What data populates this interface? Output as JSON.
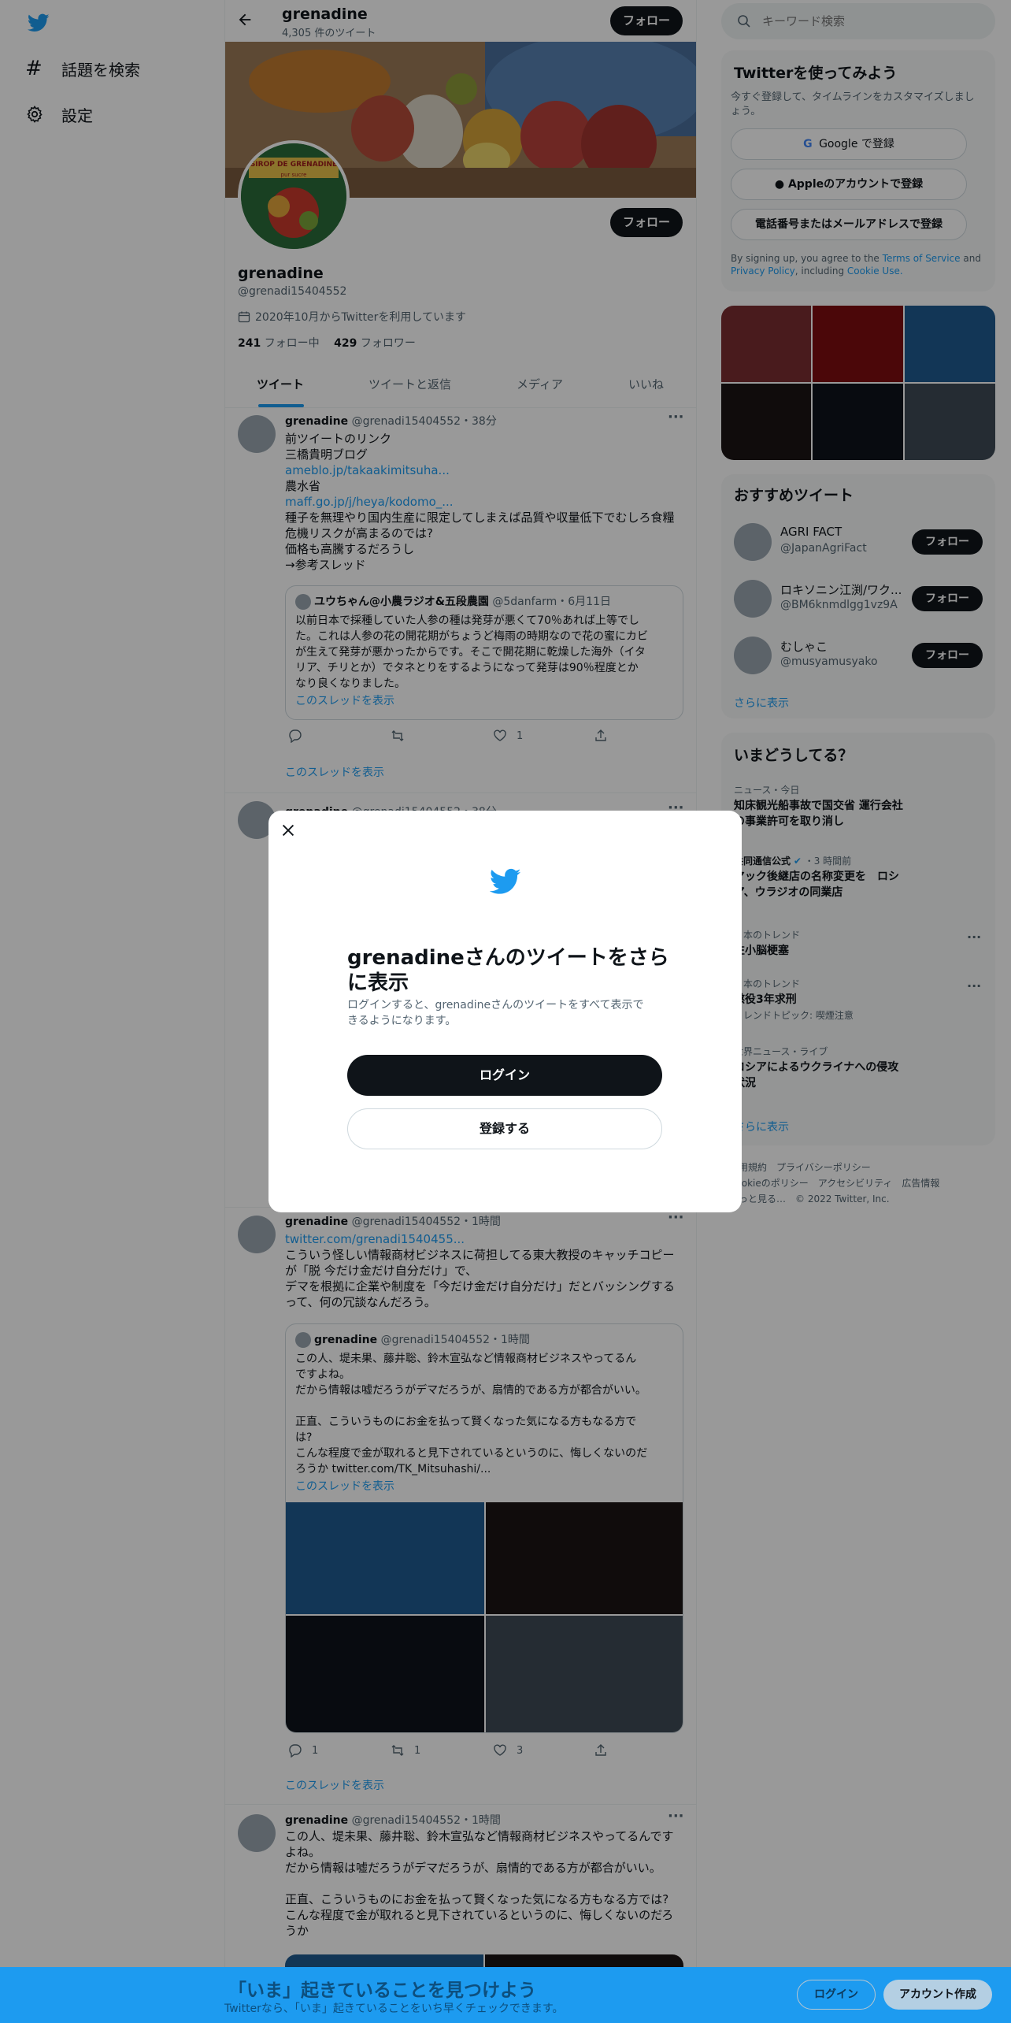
{
  "left_nav": {
    "explore_label": "話題を検索",
    "settings_label": "設定"
  },
  "header": {
    "name": "grenadine",
    "tweet_count": "4,305 件のツイート",
    "follow_label": "フォロー"
  },
  "banner": {
    "avatar_text_top": "SIROP DE GRENADINE",
    "avatar_text_sub": "pur sucre"
  },
  "profile": {
    "follow_label": "フォロー",
    "name": "grenadine",
    "handle": "@grenadi15404552",
    "joined": "2020年10月からTwitterを利用しています",
    "following_count": "241",
    "following_label": "フォロー中",
    "followers_count": "429",
    "followers_label": "フォロワー"
  },
  "tabs": [
    "ツイート",
    "ツイートと返信",
    "メディア",
    "いいね"
  ],
  "tweet1": {
    "name": "grenadine",
    "meta": "@grenadi15404552・38分",
    "lines": [
      "前ツイートのリンク",
      "三橋貴明ブログ"
    ],
    "link1": "ameblo.jp/takaakimitsuha...",
    "line3": "農水省",
    "link2": "maff.go.jp/j/heya/kodomo_...",
    "lines2": [
      "種子を無理やり国内生産に限定してしまえば品質や収量低下でむしろ食糧",
      "危機リスクが高まるのでは?",
      "価格も高騰するだろうし",
      "→参考スレッド"
    ],
    "quote": {
      "name": "ユウちゃん@小農ラジオ&五段農園",
      "meta": "@5danfarm・6月11日",
      "lines": [
        "以前日本で採種していた人参の種は発芽が悪くて70％あれば上等でし",
        "た。これは人参の花の開花期がちょうど梅雨の時期なので花の蜜にカビ",
        "が生えて発芽が悪かったからです。そこで開花期に乾燥した海外（イタ",
        "リア、チリとか）でタネとりをするようになって発芽は90％程度とか",
        "なり良くなりました。"
      ],
      "thread_link": "このスレッドを表示"
    },
    "like_count": "1",
    "thread_link": "このスレッドを表示"
  },
  "tweet2": {
    "name": "grenadine",
    "meta": "@grenadi15404552・38分"
  },
  "tweet3": {
    "name": "grenadine",
    "meta": "@grenadi15404552・1時間",
    "link": "twitter.com/grenadi1540455...",
    "lines": [
      "こういう怪しい情報商材ビジネスに荷担してる東大教授のキャッチコピー",
      "が「脱 今だけ金だけ自分だけ」で、",
      "デマを根拠に企業や制度を「今だけ金だけ自分だけ」だとバッシングする",
      "って、何の冗談なんだろう。"
    ],
    "quote": {
      "name": "grenadine",
      "meta": "@grenadi15404552・1時間",
      "lines": [
        "この人、堤未果、藤井聡、鈴木宣弘など情報商材ビジネスやってるん",
        "ですよね。",
        "だから情報は嘘だろうがデマだろうが、扇情的である方が都合がいい。",
        "",
        "正直、こういうものにお金を払って賢くなった気になる方もなる方で",
        "は?",
        "こんな程度で金が取れると見下されているというのに、悔しくないのだ",
        "ろうか  twitter.com/TK_Mitsuhashi/..."
      ],
      "thread_link": "このスレッドを表示"
    },
    "reply_count": "1",
    "retweet_count": "1",
    "like_count": "3",
    "thread_link": "このスレッドを表示"
  },
  "tweet4": {
    "name": "grenadine",
    "meta": "@grenadi15404552・1時間",
    "lines": [
      "この人、堤未果、藤井聡、鈴木宣弘など情報商材ビジネスやってるんです",
      "よね。",
      "だから情報は嘘だろうがデマだろうが、扇情的である方が都合がいい。",
      "",
      "正直、こういうものにお金を払って賢くなった気になる方もなる方では?",
      "こんな程度で金が取れると見下されているというのに、悔しくないのだろ",
      "うか"
    ]
  },
  "search": {
    "placeholder": "キーワード検索"
  },
  "signup": {
    "title": "Twitterを使ってみよう",
    "subtitle_lines": [
      "今すぐ登録して、タイムラインをカスタマイズしまし",
      "ょう。"
    ],
    "google_label": "Google で登録",
    "apple_label": "Appleのアカウントで登録",
    "phone_label": "電話番号またはメールアドレスで登録",
    "terms_pre": "By signing up, you agree to the",
    "terms_link": "Terms of Service",
    "terms_and": "and",
    "privacy_link": "Privacy Policy",
    "including": ", including",
    "cookie_link": "Cookie Use."
  },
  "colors": {
    "accent": "#1d9bf0",
    "grid": [
      "#7b2e31",
      "#7e0d0f",
      "#1f5b8f",
      "#1b1415",
      "#0e131c",
      "#3f4a56"
    ]
  },
  "recommend": {
    "title": "おすすめツイート",
    "users": [
      {
        "name": "AGRI FACT",
        "handle": "@JapanAgriFact",
        "follow": "フォロー"
      },
      {
        "name": "ロキソニン江渕/ワク...",
        "handle": "@BM6knmdlgg1vz9A",
        "follow": "フォロー"
      },
      {
        "name": "むしゃこ",
        "handle": "@musyamusyako",
        "follow": "フォロー"
      }
    ],
    "more": "さらに表示"
  },
  "trends": {
    "title": "いまどうしてる？",
    "items": [
      {
        "meta": "ニュース・今日",
        "title_lines": [
          "知床観光船事故で国交省 運行会社",
          "の事業許可を取り消し"
        ]
      },
      {
        "meta": "共同通信公式",
        "meta2": "・3 時間前",
        "title_lines": [
          "マック後継店の名称変更を　ロシ",
          "ア、ウラジオの同業店"
        ]
      },
      {
        "meta": "日本のトレンド",
        "title_lines": [
          "左小脳梗塞"
        ]
      },
      {
        "meta": "日本のトレンド",
        "title_lines": [
          "懲役3年求刑"
        ],
        "extra": "トレンドトピック: 喫煙注意"
      },
      {
        "meta": "世界ニュース・ライブ",
        "title_lines": [
          "ロシアによるウクライナへの侵攻",
          "状況"
        ]
      }
    ],
    "more": "さらに表示"
  },
  "footer": {
    "line1": "利用規約　プライバシーポリシー",
    "line2": "Cookieのポリシー　アクセシビリティ　広告情報",
    "line3": "もっと見る…　© 2022 Twitter, Inc."
  },
  "modal": {
    "title_lines": [
      "grenadineさんのツイートをさら",
      "に表示"
    ],
    "body_lines": [
      "ログインすると、grenadineさんのツイートをすべて表示で",
      "きるようになります。"
    ],
    "login_label": "ログイン",
    "signup_label": "登録する"
  },
  "bottom": {
    "headline": "「いま」起きていることを見つけよう",
    "sub": "Twitterなら、「いま」起きていることをいち早くチェックできます。",
    "login_label": "ログイン",
    "signup_label": "アカウント作成"
  }
}
